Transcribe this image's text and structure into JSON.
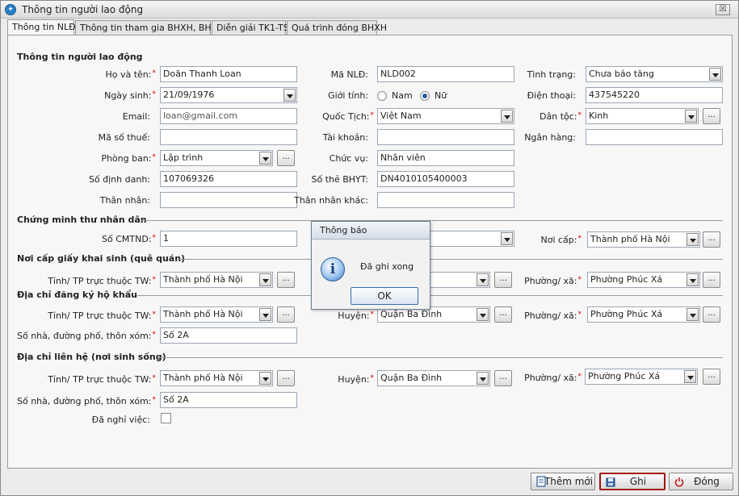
{
  "window": {
    "title": "Thông tin người lao động",
    "close_symbol": "☒"
  },
  "tabs": [
    "Thông tin NLĐ",
    "Thông tin tham gia BHXH, BHYT",
    "Diễn giải TK1-TS",
    "Quá trình đóng BHXH"
  ],
  "sections": {
    "worker_info": "Thông tin người lao động",
    "id_card": "Chứng minh thư nhân dân",
    "birth_cert": "Nơi cấp giấy khai sinh (quê quán)",
    "registered_address": "Địa chỉ đăng ký hộ khẩu",
    "contact_address": "Địa chỉ liên hệ (nơi sinh sống)"
  },
  "labels": {
    "full_name": "Họ và tên:",
    "dob": "Ngày sinh:",
    "email": "Email:",
    "tax_code": "Mã số thuế:",
    "department": "Phòng ban:",
    "id_number": "Số định danh:",
    "relative": "Thân nhân:",
    "employee_code": "Mã NLĐ:",
    "gender": "Giới tính:",
    "nationality": "Quốc Tịch:",
    "account": "Tài khoản:",
    "position": "Chức vụ:",
    "bhyt_card": "Số thẻ BHYT:",
    "other_relative": "Thân nhân khác:",
    "status": "Tình trạng:",
    "phone": "Điện thoại:",
    "ethnicity": "Dân tộc:",
    "bank": "Ngân hàng:",
    "cmtnd_number": "Số CMTND:",
    "issue_place": "Nơi cấp:",
    "province": "Tỉnh/ TP trực thuộc TW:",
    "district": "Huyện:",
    "ward": "Phường/ xã:",
    "street": "Số nhà, đường phố, thôn xóm:",
    "resigned": "Đã nghỉ việc:"
  },
  "gender_options": {
    "male": "Nam",
    "female": "Nữ",
    "selected": "Nữ"
  },
  "values": {
    "full_name": "Doãn Thanh Loan",
    "dob": "21/09/1976",
    "email": "loan@gmail.com",
    "tax_code": "",
    "department": "Lập trình",
    "id_number": "107069326",
    "relative": "",
    "employee_code": "NLD002",
    "nationality": "Việt Nam",
    "account": "",
    "position": "Nhân viên",
    "bhyt_card": "DN4010105400003",
    "other_relative": "",
    "status": "Chưa báo tăng",
    "phone": "437545220",
    "ethnicity": "Kinh",
    "bank": "",
    "cmtnd_number": "1",
    "cmtnd_issue_place": "Thành phố Hà Nội",
    "birth_province": "Thành phố Hà Nội",
    "birth_ward": "Phường Phúc Xá",
    "reg_province": "Thành phố Hà Nội",
    "reg_district": "Quận Ba Đình",
    "reg_ward": "Phường Phúc Xá",
    "reg_street": "Số 2A",
    "contact_province": "Thành phố Hà Nội",
    "contact_district": "Quận Ba Đình",
    "contact_ward": "Phường Phúc Xá",
    "contact_street": "Số 2A",
    "resigned_checked": false
  },
  "buttons": {
    "ellipsis": "...",
    "add_new": "Thêm mới",
    "save": "Ghi",
    "close": "Đóng"
  },
  "dialog": {
    "title": "Thông báo",
    "message": "Đã ghi xong",
    "ok": "OK",
    "info_symbol": "i"
  }
}
